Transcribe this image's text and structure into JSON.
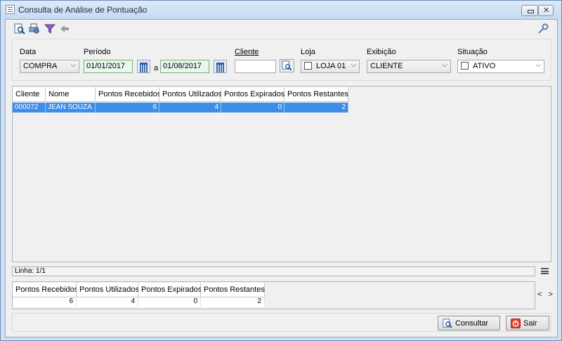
{
  "window": {
    "title": "Consulta de Análise de Pontuação"
  },
  "toolbar": {
    "icons": [
      "search-doc-icon",
      "print-icon",
      "filter-icon",
      "back-arrow-icon",
      "key-icon"
    ]
  },
  "filters": {
    "data": {
      "label": "Data",
      "value": "COMPRA"
    },
    "periodo": {
      "label": "Período",
      "from": "01/01/2017",
      "sep": "a",
      "to": "01/08/2017"
    },
    "cliente": {
      "label": "Cliente",
      "value": ""
    },
    "loja": {
      "label": "Loja",
      "value": "LOJA 01"
    },
    "exibicao": {
      "label": "Exibição",
      "value": "CLIENTE"
    },
    "situacao": {
      "label": "Situação",
      "value": "ATIVO"
    }
  },
  "table": {
    "columns": [
      "Cliente",
      "Nome",
      "Pontos Recebidos",
      "Pontos Utilizados",
      "Pontos Expirados",
      "Pontos Restantes"
    ],
    "rows": [
      [
        "000072",
        "JEAN SOUZA",
        "6",
        "4",
        "0",
        "2"
      ]
    ]
  },
  "status": {
    "linha": "Linha: 1/1"
  },
  "totals": {
    "columns": [
      "Pontos Recebidos",
      "Pontos Utilizados",
      "Pontos Expirados",
      "Pontos Restantes"
    ],
    "values": [
      "6",
      "4",
      "0",
      "2"
    ],
    "nav": "< >"
  },
  "buttons": {
    "consultar": "Consultar",
    "sair": "Sair"
  },
  "colors": {
    "selection": "#3d8ee8",
    "date_bg": "#e9f7ec",
    "window_frame": "#cfe0f3"
  }
}
